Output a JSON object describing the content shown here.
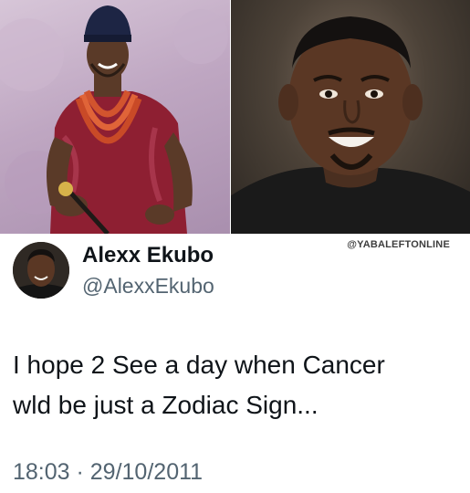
{
  "watermark": "@YABALEFTONLINE",
  "tweet": {
    "display_name": "Alexx Ekubo",
    "handle": "@AlexxEkubo",
    "text_lines": [
      "I hope 2 See a day when Cancer",
      "wld be just a Zodiac Sign..."
    ],
    "timestamp": "18:03 · 29/10/2011"
  },
  "icons": {
    "avatar": "profile-photo",
    "left_photo": "man-in-traditional-attire-photo",
    "right_photo": "smiling-man-portrait-photo"
  },
  "colors": {
    "text_primary": "#0f1419",
    "text_secondary": "#536471",
    "background": "#ffffff"
  }
}
